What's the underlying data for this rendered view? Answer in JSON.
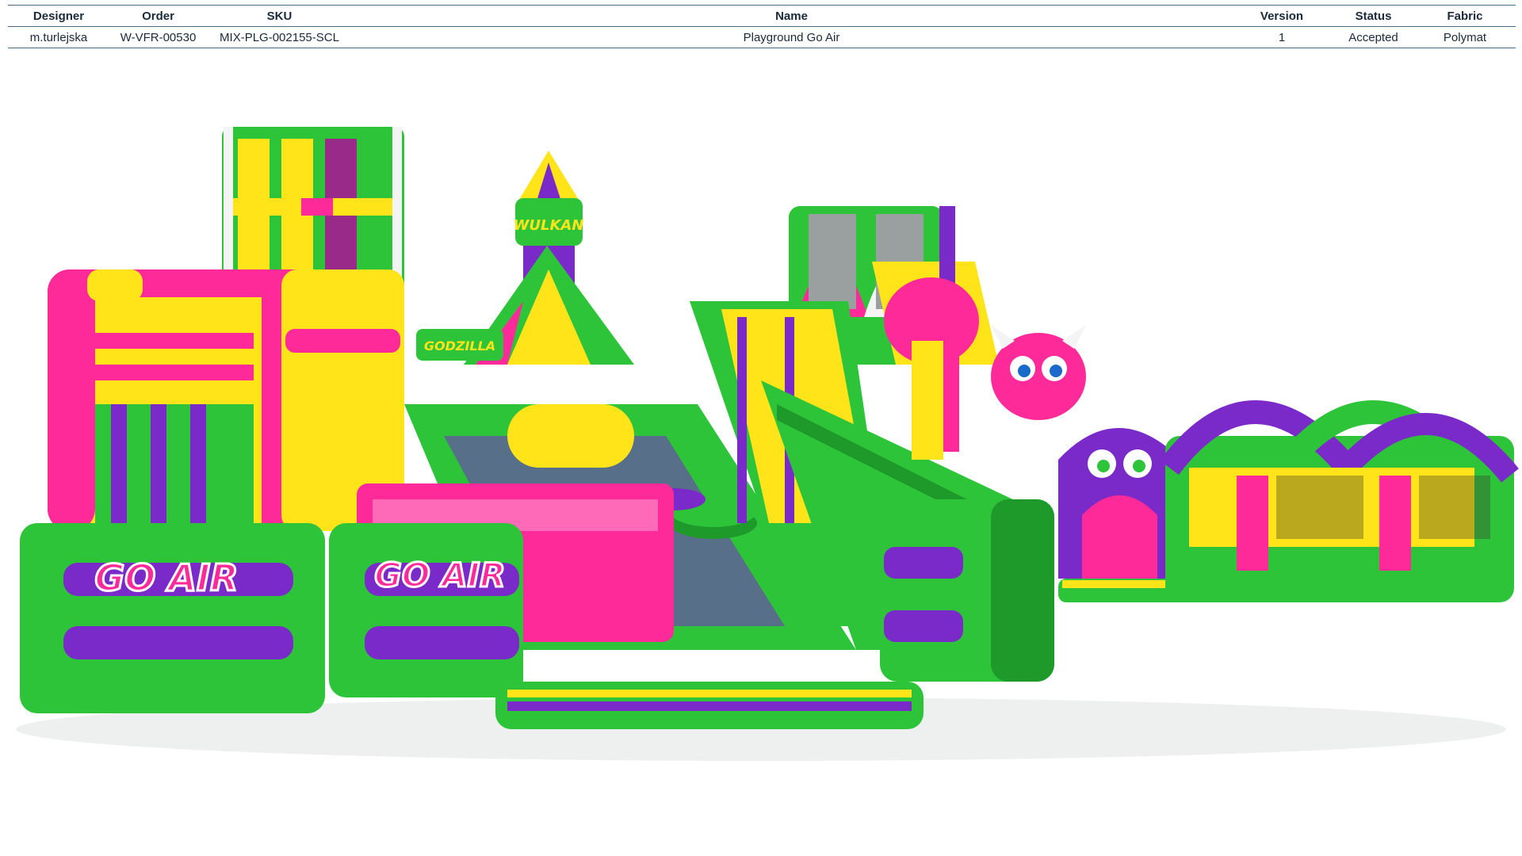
{
  "table": {
    "headers": {
      "designer": "Designer",
      "order": "Order",
      "sku": "SKU",
      "name": "Name",
      "version": "Version",
      "status": "Status",
      "fabric": "Fabric"
    },
    "row": {
      "designer": "m.turlejska",
      "order": "W-VFR-00530",
      "sku": "MIX-PLG-002155-SCL",
      "name": "Playground Go Air",
      "version": "1",
      "status": "Accepted",
      "fabric": "Polymat"
    }
  },
  "render": {
    "brand_logo_text": "GO AIR",
    "tower_sign_text": "WULKAN",
    "side_sign_text": "GODZILLA",
    "colors": {
      "green": "#2ec43a",
      "dark_green": "#1e9a2a",
      "pink": "#ff2a9a",
      "yellow": "#ffe41a",
      "purple": "#7a2ac8",
      "white": "#f4f4f4"
    }
  }
}
